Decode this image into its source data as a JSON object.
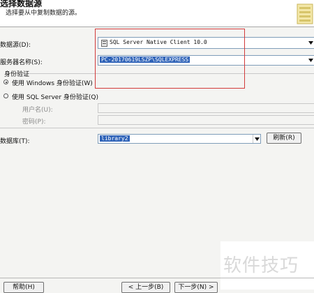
{
  "header": {
    "title": "选择数据源",
    "subtitle": "选择要从中复制数据的源。"
  },
  "form": {
    "data_source_label": "数据源(D):",
    "data_source_value": "SQL Server Native Client 10.0",
    "server_name_label": "服务器名称(S):",
    "server_name_value": "PC-20170619LSZP\\SQLEXPRESS",
    "auth_group_label": "身份验证",
    "windows_auth_label": "使用 Windows 身份验证(W)",
    "sql_auth_label": "使用 SQL Server 身份验证(Q)",
    "username_label": "用户名(U):",
    "password_label": "密码(P):",
    "database_label": "数据库(T):",
    "database_value": "library2",
    "refresh_button": "刷新(R)"
  },
  "auth_selected": "windows",
  "footer": {
    "help_button": "帮助(H)",
    "back_button": "< 上一步(B)",
    "next_button": "下一步(N) >"
  },
  "watermark": "软件技巧",
  "colors": {
    "highlight": "#2f63b8",
    "annotation_box": "#d23b3b"
  }
}
